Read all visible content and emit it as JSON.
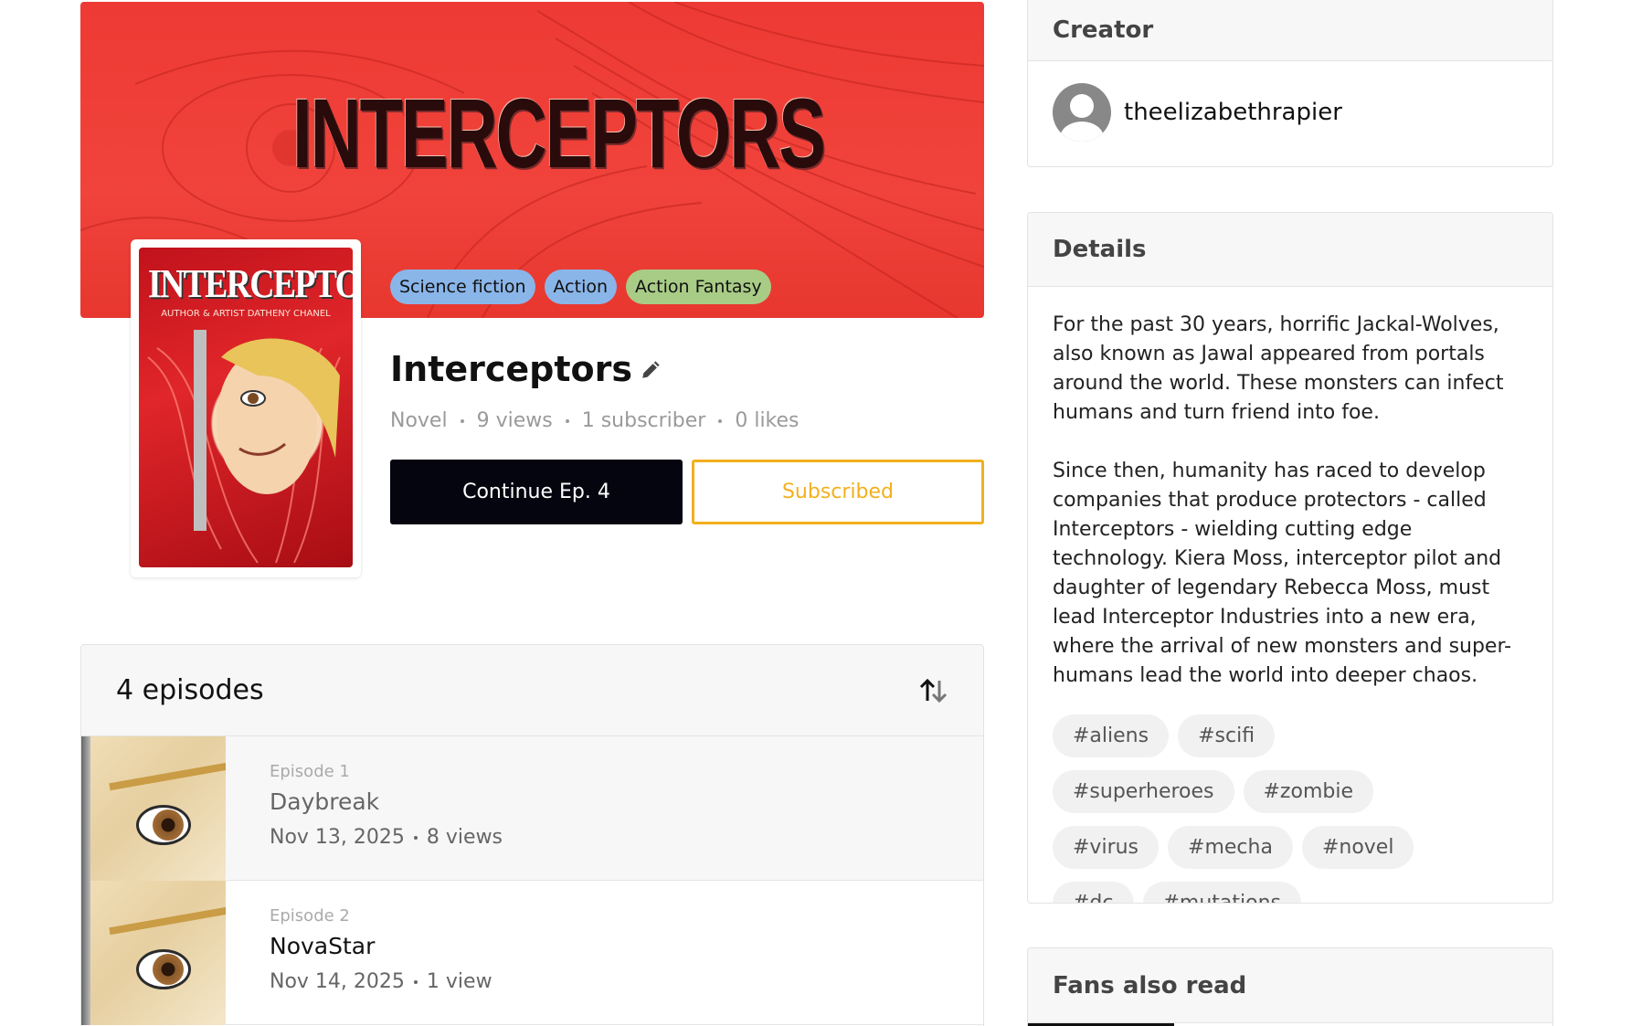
{
  "banner": {
    "title": "INTERCEPTORS",
    "genres": [
      {
        "label": "Science fiction",
        "color": "#8ab5e8"
      },
      {
        "label": "Action",
        "color": "#8ab5e8"
      },
      {
        "label": "Action Fantasy",
        "color": "#a8cc86"
      }
    ]
  },
  "cover": {
    "title": "INTERCEPTORS",
    "credit": "AUTHOR & ARTIST DATHENY CHANEL"
  },
  "series": {
    "title": "Interceptors",
    "type": "Novel",
    "views": "9 views",
    "subscribers": "1 subscriber",
    "likes": "0 likes",
    "continue_label": "Continue Ep. 4",
    "subscribed_label": "Subscribed"
  },
  "episodes": {
    "count_label": "4 episodes",
    "items": [
      {
        "number": "Episode 1",
        "title": "Daybreak",
        "date": "Nov 13, 2025",
        "views": "8 views"
      },
      {
        "number": "Episode 2",
        "title": "NovaStar",
        "date": "Nov 14, 2025",
        "views": "1 view"
      }
    ]
  },
  "creator": {
    "heading": "Creator",
    "name": "theelizabethrapier"
  },
  "details": {
    "heading": "Details",
    "paragraphs": [
      "For the past 30 years, horrific Jackal-Wolves, also known as Jawal appeared from portals around the world. These monsters can infect humans and turn friend into foe.",
      "Since then, humanity has raced to develop companies that produce protectors - called Interceptors - wielding cutting edge technology. Kiera Moss, interceptor pilot and daughter of legendary Rebecca Moss, must lead Interceptor Industries into a new era, where the arrival of new monsters and super-humans lead the world into deeper chaos."
    ],
    "tags": [
      "#aliens",
      "#scifi",
      "#superheroes",
      "#zombie",
      "#virus",
      "#mecha",
      "#novel",
      "#dc",
      "#mutations"
    ]
  },
  "fans": {
    "heading": "Fans also read"
  },
  "colors": {
    "banner_red": "#ee3a34",
    "accent_yellow": "#f2b01e",
    "button_dark": "#05050f"
  }
}
